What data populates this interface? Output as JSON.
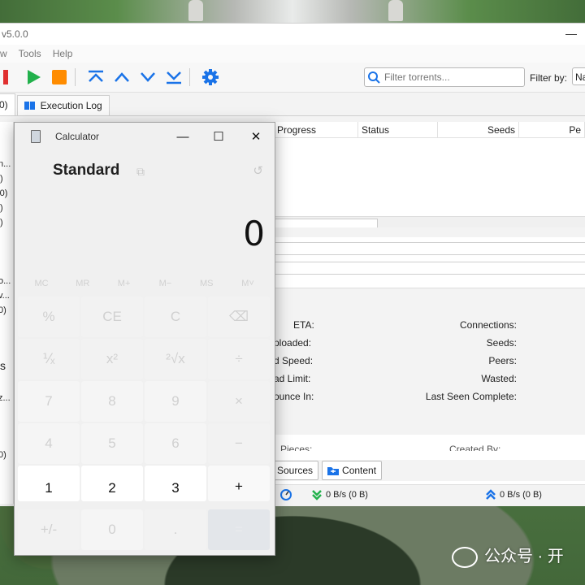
{
  "app": {
    "title_fragment": "v5.0.0",
    "menu": [
      "w",
      "Tools",
      "Help"
    ],
    "search": {
      "placeholder": "Filter torrents..."
    },
    "filter_by_label": "Filter by:",
    "filter_by_value": "Na",
    "tabs": [
      {
        "label": "0)",
        "icon": "partial-tab"
      },
      {
        "label": "Execution Log",
        "icon": "book-icon"
      }
    ],
    "sidebar_fragments": [
      "n...",
      ")",
      "(0)",
      ")",
      ")",
      "o...",
      "v...",
      "0)",
      "s",
      "z...",
      "0)"
    ],
    "columns": [
      "Progress",
      "Status",
      "Seeds",
      "Pe"
    ],
    "properties": {
      "left": [
        "ETA:",
        "ploaded:",
        "d Speed:",
        "ad Limit:",
        "ounce In:"
      ],
      "right": [
        "Connections:",
        "Seeds:",
        "Peers:",
        "Wasted:",
        "Last Seen Complete:"
      ],
      "bottom_left": "Pieces:",
      "bottom_right": "Created By:"
    },
    "prop_tabs": [
      "Sources",
      "Content"
    ],
    "status": {
      "down": "0 B/s (0 B)",
      "up": "0 B/s (0 B)"
    },
    "colors": {
      "accent": "#1a73e8",
      "play": "#22b14c",
      "stop": "#ff8c00",
      "red": "#e03030"
    }
  },
  "calculator": {
    "title": "Calculator",
    "mode": "Standard",
    "display": "0",
    "memory": [
      "MC",
      "MR",
      "M+",
      "M−",
      "MS",
      "M˅"
    ],
    "keys": [
      [
        "%",
        "CE",
        "C",
        "⌫"
      ],
      [
        "⅟ₓ",
        "x²",
        "²√x",
        "÷"
      ],
      [
        "7",
        "8",
        "9",
        "×"
      ],
      [
        "4",
        "5",
        "6",
        "−"
      ],
      [
        "1",
        "2",
        "3",
        "+"
      ],
      [
        "+/-",
        "0",
        ".",
        "="
      ]
    ]
  },
  "watermark": "公众号 · 开"
}
